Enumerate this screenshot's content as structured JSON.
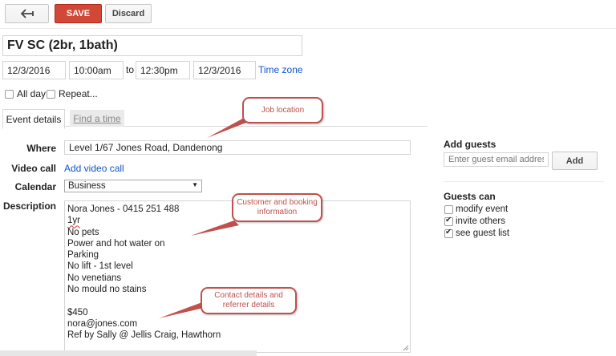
{
  "toolbar": {
    "back_icon": "back-arrow-icon",
    "save_label": "SAVE",
    "discard_label": "Discard"
  },
  "event": {
    "title": "FV SC (2br, 1bath)",
    "start_date": "12/3/2016",
    "start_time": "10:00am",
    "to_label": "to",
    "end_time": "12:30pm",
    "end_date": "12/3/2016",
    "timezone_label": "Time zone",
    "all_day_label": "All day",
    "all_day_checked": false,
    "repeat_label": "Repeat...",
    "repeat_checked": false
  },
  "tabs": [
    {
      "label": "Event details",
      "active": true
    },
    {
      "label": "Find a time",
      "active": false
    }
  ],
  "details": {
    "where_label": "Where",
    "where_value": "Level 1/67 Jones Road, Dandenong",
    "video_label": "Video call",
    "video_link": "Add video call",
    "calendar_label": "Calendar",
    "calendar_value": "Business",
    "description_label": "Description",
    "description_lines": [
      "Nora Jones - 0415 251 488",
      "1yr",
      "No pets",
      "Power and hot water on",
      "Parking",
      "No lift - 1st level",
      "No venetians",
      "No mould no stains",
      "",
      "$450",
      "nora@jones.com",
      "Ref by Sally @ Jellis Craig, Hawthorn"
    ]
  },
  "guests": {
    "add_title": "Add guests",
    "input_placeholder": "Enter guest email addresses",
    "add_button": "Add",
    "can_title": "Guests can",
    "options": [
      {
        "label": "modify event",
        "checked": false
      },
      {
        "label": "invite others",
        "checked": true
      },
      {
        "label": "see guest list",
        "checked": true
      }
    ]
  },
  "callouts": {
    "job_location": "Job location",
    "customer_info": "Customer and booking information",
    "contact_info": "Contact details and referrer details"
  },
  "colors": {
    "save": "#d14836",
    "link": "#1155cc",
    "callout": "#c0504d"
  }
}
